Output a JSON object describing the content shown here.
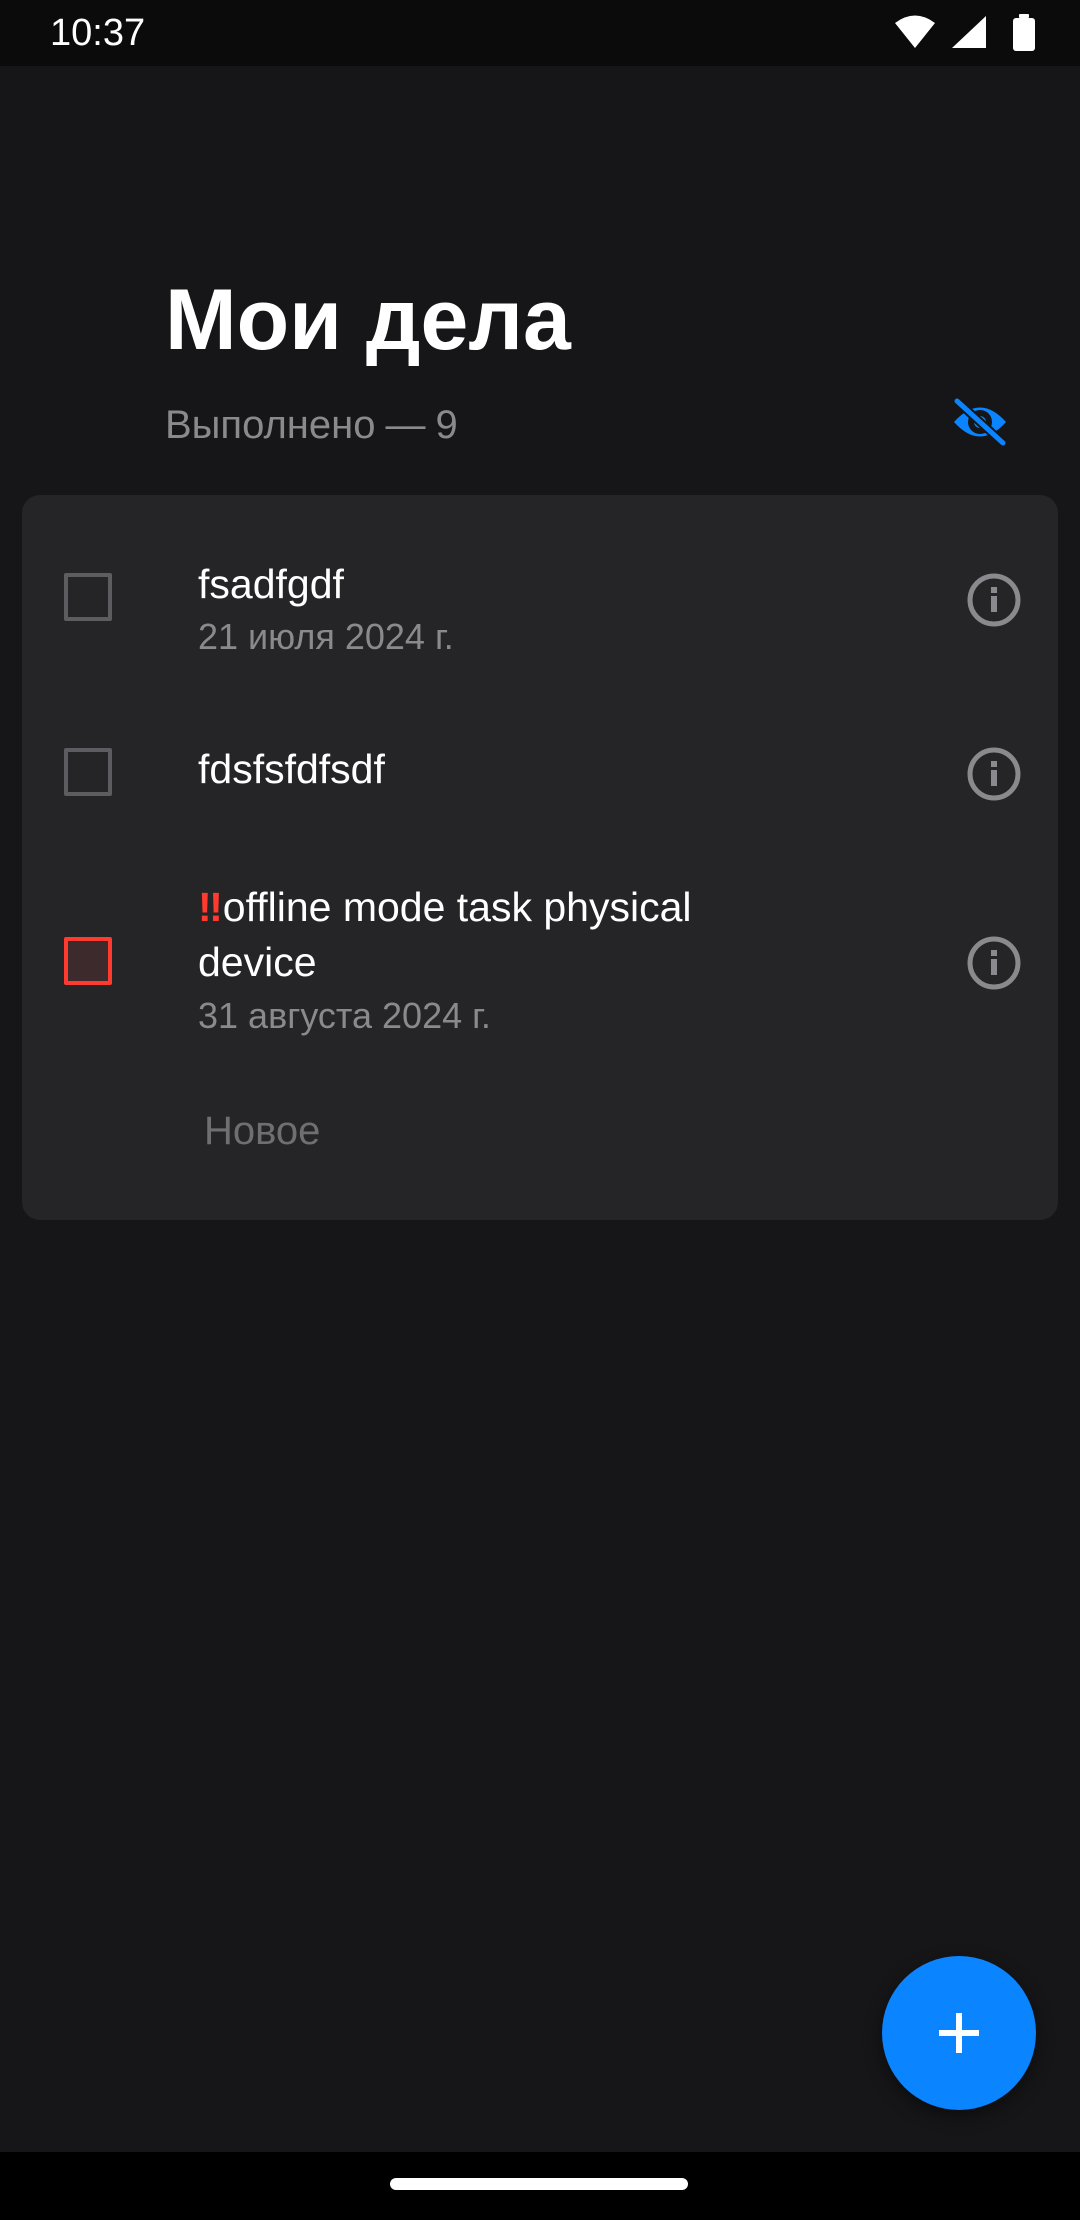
{
  "status_bar": {
    "time": "10:37",
    "icons": [
      "wifi-icon",
      "cellular-signal-icon",
      "battery-icon"
    ]
  },
  "header": {
    "title": "Мои дела",
    "done_label": "Выполнено",
    "done_separator": "—",
    "done_count": "9",
    "visibility_icon": "eye-off-icon"
  },
  "tasks": [
    {
      "text": "fsadfgdf",
      "date": "21 июля 2024 г.",
      "priority": "normal",
      "checked": false
    },
    {
      "text": "fdsfsfdfsdf",
      "date": "",
      "priority": "normal",
      "checked": false
    },
    {
      "priority_mark": "‼",
      "text": "offline mode task physical device",
      "date": "31 августа 2024 г.",
      "priority": "high",
      "checked": false
    }
  ],
  "new_task_label": "Новое",
  "fab": {
    "icon": "plus-icon"
  },
  "colors": {
    "background": "#161618",
    "card": "#252528",
    "accent": "#0a84ff",
    "priority": "#ff3b30",
    "secondary_text": "#8a8a8e"
  }
}
